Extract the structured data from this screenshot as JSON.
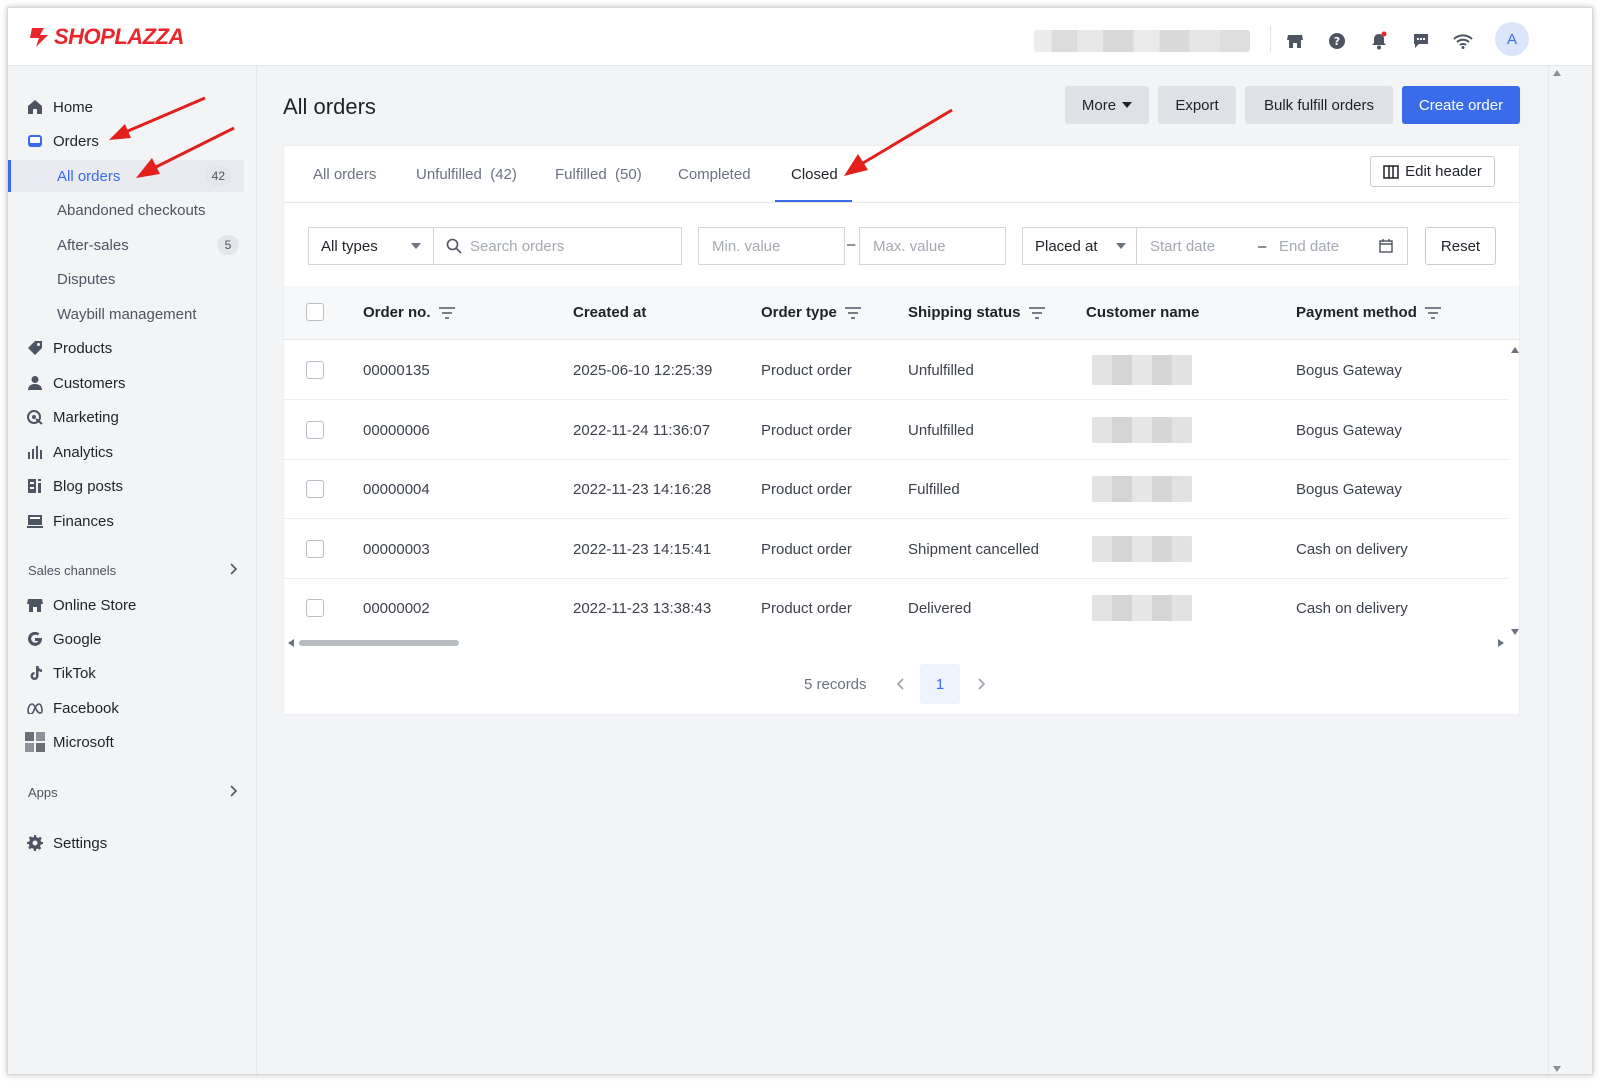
{
  "app": {
    "brand": "SHOPLAZZA",
    "brand_color": "#e8262c",
    "accent": "#3a6be8"
  },
  "topbar": {
    "icons": [
      "store-icon",
      "help-icon",
      "bell-icon",
      "chat-icon",
      "wifi-icon"
    ],
    "avatar_letter": "A"
  },
  "sidebar": {
    "home": "Home",
    "orders": "Orders",
    "orders_sub": [
      {
        "label": "All orders",
        "badge": "42",
        "active": true
      },
      {
        "label": "Abandoned checkouts"
      },
      {
        "label": "After-sales",
        "badge": "5"
      },
      {
        "label": "Disputes"
      },
      {
        "label": "Waybill management"
      }
    ],
    "products": "Products",
    "customers": "Customers",
    "marketing": "Marketing",
    "analytics": "Analytics",
    "blog_posts": "Blog posts",
    "finances": "Finances",
    "sales_channels_head": "Sales channels",
    "channels": [
      "Online Store",
      "Google",
      "TikTok",
      "Facebook",
      "Microsoft"
    ],
    "apps_head": "Apps",
    "settings": "Settings"
  },
  "main": {
    "title": "All orders",
    "buttons": {
      "more": "More",
      "export": "Export",
      "bulk": "Bulk fulfill orders",
      "create": "Create order"
    },
    "tabs": [
      "All orders",
      "Unfulfilled  (42)",
      "Fulfilled  (50)",
      "Completed",
      "Closed"
    ],
    "active_tab": "Closed",
    "edit_header": "Edit header",
    "filters": {
      "type_select": "All types",
      "search_placeholder": "Search orders",
      "min_placeholder": "Min. value",
      "dash": "–",
      "max_placeholder": "Max. value",
      "date_select": "Placed at",
      "start_placeholder": "Start date",
      "end_placeholder": "End date",
      "reset": "Reset"
    },
    "table": {
      "headers": [
        "Order no.",
        "Created at",
        "Order type",
        "Shipping status",
        "Customer name",
        "Payment method"
      ],
      "rows": [
        {
          "order": "00000135",
          "created": "2025-06-10 12:25:39",
          "type": "Product order",
          "status": "Unfulfilled",
          "payment": "Bogus Gateway"
        },
        {
          "order": "00000006",
          "created": "2022-11-24 11:36:07",
          "type": "Product order",
          "status": "Unfulfilled",
          "payment": "Bogus Gateway"
        },
        {
          "order": "00000004",
          "created": "2022-11-23 14:16:28",
          "type": "Product order",
          "status": "Fulfilled",
          "payment": "Bogus Gateway"
        },
        {
          "order": "00000003",
          "created": "2022-11-23 14:15:41",
          "type": "Product order",
          "status": "Shipment cancelled",
          "payment": "Cash on delivery"
        },
        {
          "order": "00000002",
          "created": "2022-11-23 13:38:43",
          "type": "Product order",
          "status": "Delivered",
          "payment": "Cash on delivery"
        }
      ]
    },
    "pagination": {
      "records": "5 records",
      "current": "1"
    }
  }
}
